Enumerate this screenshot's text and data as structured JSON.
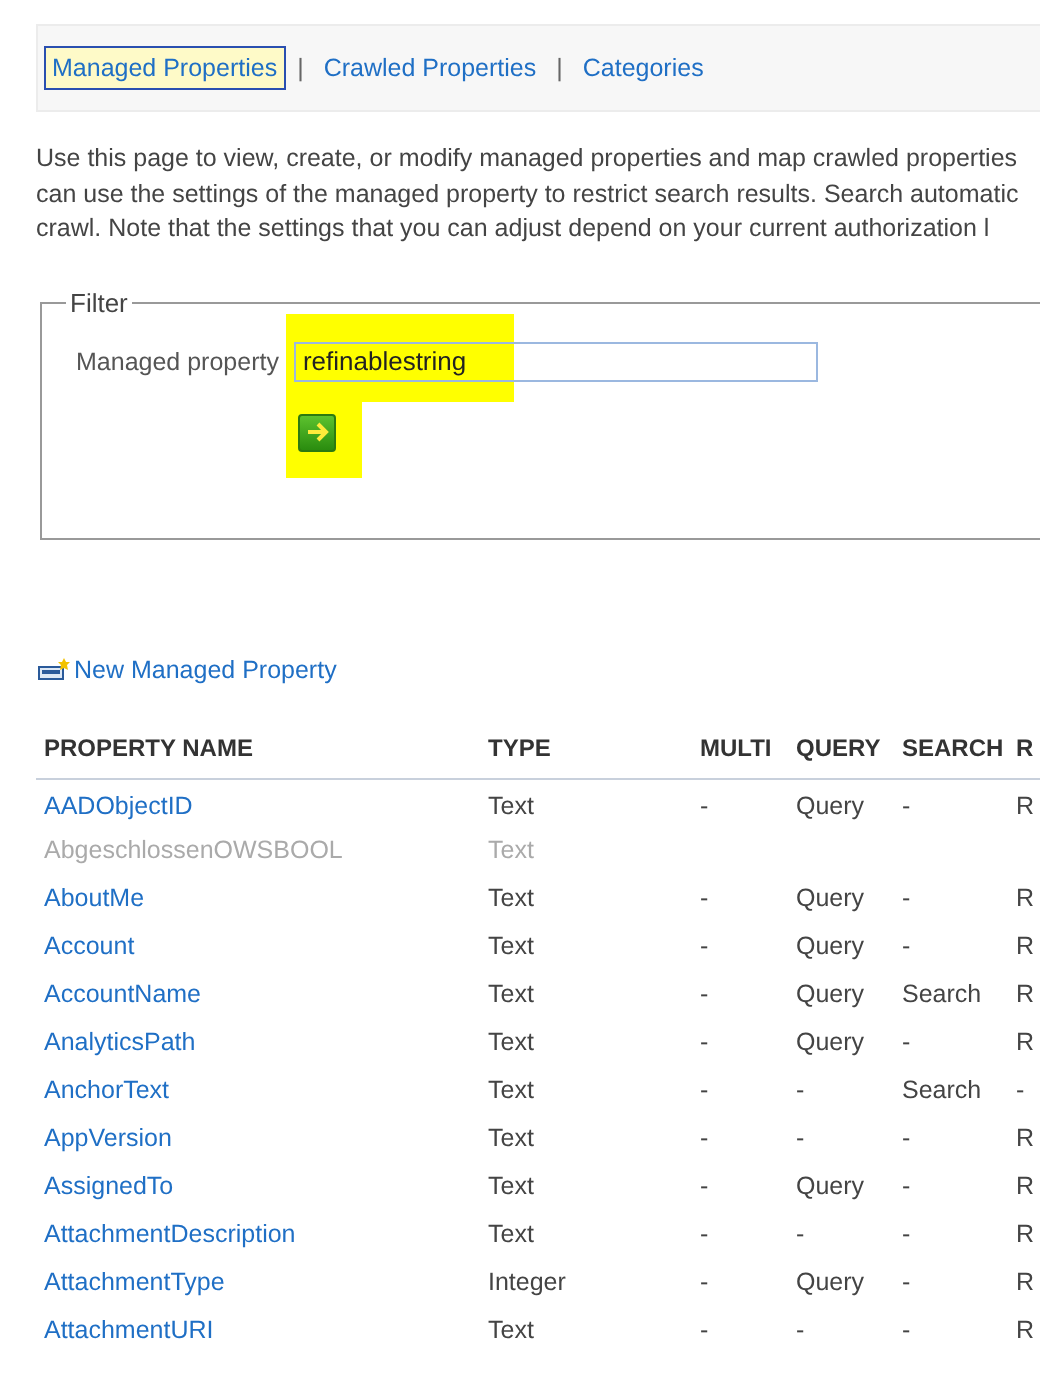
{
  "nav": [
    {
      "label": "Managed Properties",
      "selected": true
    },
    {
      "label": "Crawled Properties",
      "selected": false
    },
    {
      "label": "Categories",
      "selected": false
    }
  ],
  "nav_separators": [
    "|",
    "|"
  ],
  "description": [
    "Use this page to view, create, or modify managed properties and map crawled properties",
    "can use the settings of the managed property to restrict search results. Search automatic",
    "crawl. Note that the settings that you can adjust depend on your current authorization l"
  ],
  "filter": {
    "legend": "Filter",
    "label": "Managed property",
    "value": "refinablestring",
    "highlighted": true
  },
  "new_link": "New Managed Property",
  "table": {
    "columns": [
      "PROPERTY NAME",
      "TYPE",
      "MULTI",
      "QUERY",
      "SEARCH",
      "R"
    ],
    "rows": [
      {
        "cells": [
          "AADObjectID",
          "Text",
          "-",
          "Query",
          "-",
          "R"
        ],
        "disabled": false
      },
      {
        "cells": [
          "AbgeschlossenOWSBOOL",
          "Text"
        ],
        "disabled": true
      },
      {
        "cells": [
          "AboutMe",
          "Text",
          "-",
          "Query",
          "-",
          "R"
        ],
        "disabled": false
      },
      {
        "cells": [
          "Account",
          "Text",
          "-",
          "Query",
          "-",
          "R"
        ],
        "disabled": false
      },
      {
        "cells": [
          "AccountName",
          "Text",
          "-",
          "Query",
          "Search",
          "R"
        ],
        "disabled": false
      },
      {
        "cells": [
          "AnalyticsPath",
          "Text",
          "-",
          "Query",
          "-",
          "R"
        ],
        "disabled": false
      },
      {
        "cells": [
          "AnchorText",
          "Text",
          "-",
          "-",
          "Search",
          "-"
        ],
        "disabled": false
      },
      {
        "cells": [
          "AppVersion",
          "Text",
          "-",
          "-",
          "-",
          "R"
        ],
        "disabled": false
      },
      {
        "cells": [
          "AssignedTo",
          "Text",
          "-",
          "Query",
          "-",
          "R"
        ],
        "disabled": false
      },
      {
        "cells": [
          "AttachmentDescription",
          "Text",
          "-",
          "-",
          "-",
          "R"
        ],
        "disabled": false
      },
      {
        "cells": [
          "AttachmentType",
          "Integer",
          "-",
          "Query",
          "-",
          "R"
        ],
        "disabled": false
      },
      {
        "cells": [
          "AttachmentURI",
          "Text",
          "-",
          "-",
          "-",
          "R"
        ],
        "disabled": false
      }
    ]
  }
}
